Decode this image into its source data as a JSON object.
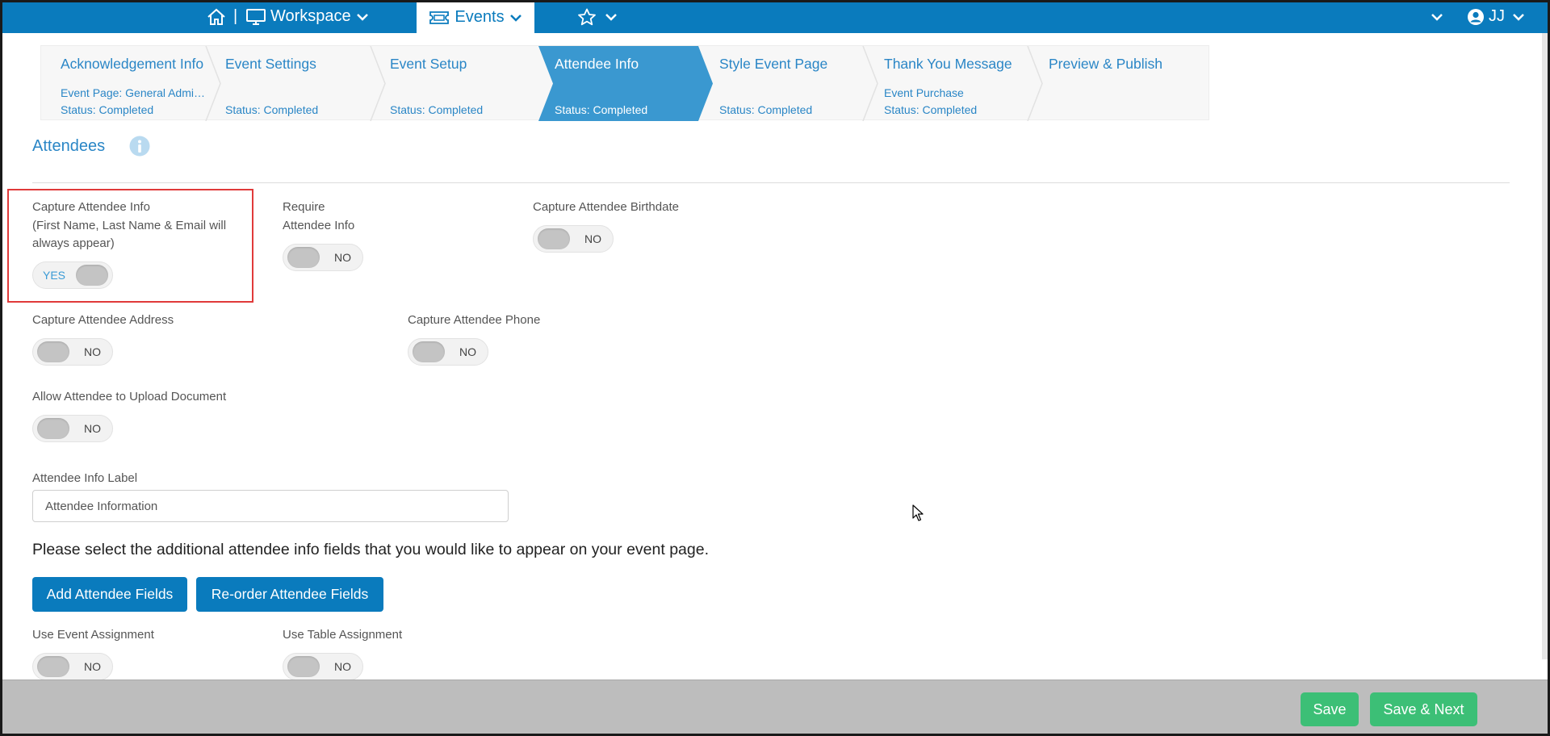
{
  "topnav": {
    "separator": "|",
    "workspace_label": "Workspace",
    "events_label": "Events",
    "user_initials": "JJ"
  },
  "wizard": {
    "steps": [
      {
        "title": "Acknowledgement Info",
        "sub": "Event Page: General Admis...",
        "status": "Status: Completed"
      },
      {
        "title": "Event Settings",
        "sub": "",
        "status": "Status: Completed"
      },
      {
        "title": "Event Setup",
        "sub": "",
        "status": "Status: Completed"
      },
      {
        "title": "Attendee Info",
        "sub": "",
        "status": "Status: Completed"
      },
      {
        "title": "Style Event Page",
        "sub": "",
        "status": "Status: Completed"
      },
      {
        "title": "Thank You Message",
        "sub": "Event Purchase",
        "status": "Status: Completed"
      },
      {
        "title": "Preview & Publish",
        "sub": "",
        "status": ""
      }
    ],
    "active_index": 3
  },
  "section": {
    "title": "Attendees"
  },
  "settings": {
    "capture_info": {
      "line1": "Capture Attendee Info",
      "line2": "(First Name, Last Name & Email will",
      "line3": "always appear)",
      "state": "YES"
    },
    "require_info": {
      "line1": "Require",
      "line2": "Attendee Info",
      "state": "NO"
    },
    "capture_birthdate": {
      "label": "Capture Attendee Birthdate",
      "state": "NO"
    },
    "capture_address": {
      "label": "Capture Attendee Address",
      "state": "NO"
    },
    "capture_phone": {
      "label": "Capture Attendee Phone",
      "state": "NO"
    },
    "upload_document": {
      "label": "Allow Attendee to Upload Document",
      "state": "NO"
    },
    "info_label": {
      "label": "Attendee Info Label",
      "value": "Attendee Information"
    },
    "prompt": "Please select the additional attendee info fields that you would like to appear on your event page.",
    "add_fields_button": "Add Attendee Fields",
    "reorder_fields_button": "Re-order Attendee Fields",
    "event_assignment": {
      "label": "Use Event Assignment",
      "state": "NO"
    },
    "table_assignment": {
      "label": "Use Table Assignment",
      "state": "NO"
    }
  },
  "footer": {
    "save_label": "Save",
    "save_next_label": "Save & Next"
  },
  "colors": {
    "nav_blue": "#0a7bbd",
    "link_blue": "#2a86c6",
    "active_step": "#3a98d0",
    "save_green": "#3cbf76",
    "highlight_red": "#e03a3a"
  }
}
